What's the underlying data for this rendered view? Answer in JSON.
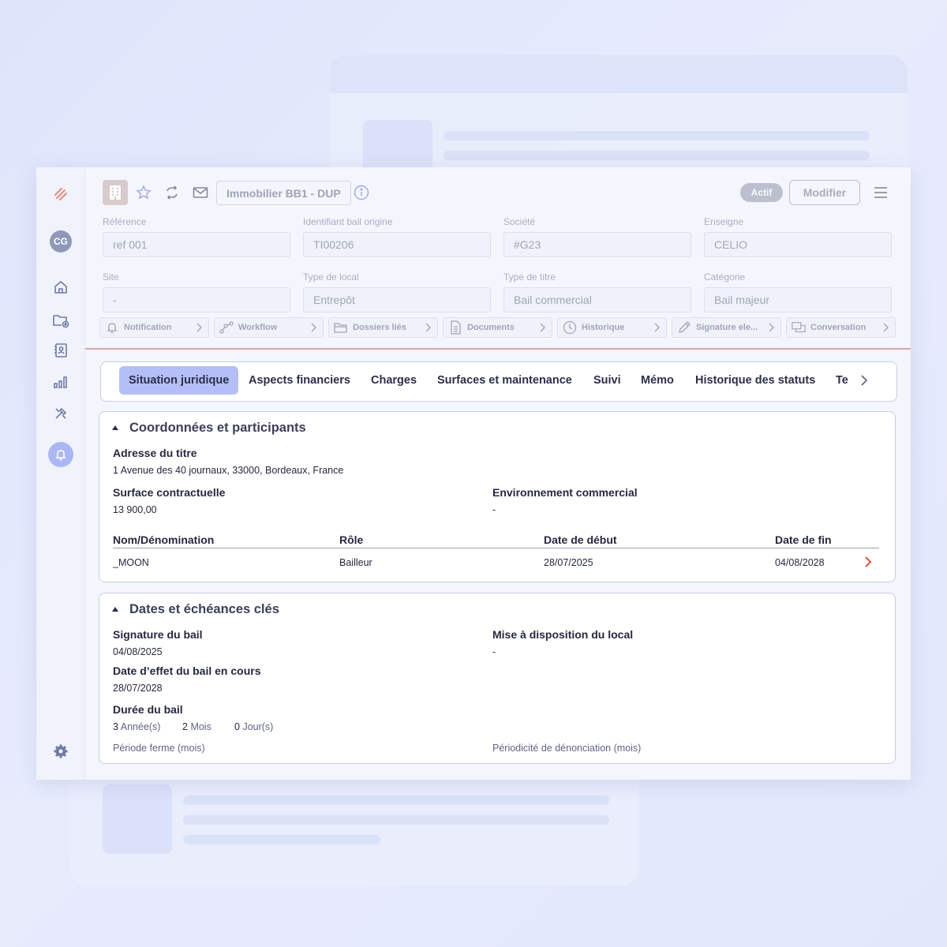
{
  "header": {
    "title": "Immobilier BB1 - DUP",
    "status": "Actif",
    "modify_label": "Modifier"
  },
  "sidebar": {
    "avatar_initials": "CG",
    "items": [
      "home-icon",
      "folder-add-icon",
      "contacts-icon",
      "chart-icon",
      "tools-icon",
      "bell-icon",
      "settings-icon"
    ]
  },
  "fields": [
    {
      "label": "Référence",
      "value": "ref 001"
    },
    {
      "label": "Identifiant bail origine",
      "value": "TI00206"
    },
    {
      "label": "Société",
      "value": "#G23"
    },
    {
      "label": "Enseigne",
      "value": "CELIO"
    },
    {
      "label": "Site",
      "value": "-"
    },
    {
      "label": "Type de local",
      "value": "Entrepôt"
    },
    {
      "label": "Type de titre",
      "value": "Bail commercial"
    },
    {
      "label": "Catégorie",
      "value": "Bail majeur"
    }
  ],
  "quick_links": [
    {
      "label": "Notification",
      "icon": "bell-icon"
    },
    {
      "label": "Workflow",
      "icon": "workflow-icon"
    },
    {
      "label": "Dossiers liés",
      "icon": "folder-icon"
    },
    {
      "label": "Documents",
      "icon": "document-icon"
    },
    {
      "label": "Historique",
      "icon": "clock-icon"
    },
    {
      "label": "Signature ele...",
      "icon": "pen-icon"
    },
    {
      "label": "Conversation",
      "icon": "chat-icon"
    }
  ],
  "tabs": [
    {
      "label": "Situation juridique",
      "active": true
    },
    {
      "label": "Aspects financiers"
    },
    {
      "label": "Charges"
    },
    {
      "label": "Surfaces et maintenance"
    },
    {
      "label": "Suivi"
    },
    {
      "label": "Mémo"
    },
    {
      "label": "Historique des statuts"
    },
    {
      "label": "Te"
    }
  ],
  "coords": {
    "title": "Coordonnées et participants",
    "address_label": "Adresse du titre",
    "address_value": "1 Avenue des 40 journaux, 33000, Bordeaux, France",
    "surface_label": "Surface contractuelle",
    "surface_value": "13 900,00",
    "env_label": "Environnement commercial",
    "env_value": "-",
    "table": {
      "headers": [
        "Nom/Dénomination",
        "Rôle",
        "Date de début",
        "Date de fin"
      ],
      "rows": [
        [
          "_MOON",
          "Bailleur",
          "28/07/2025",
          "04/08/2028"
        ]
      ]
    }
  },
  "dates": {
    "title": "Dates et échéances clés",
    "signature_label": "Signature du bail",
    "signature_value": "04/08/2025",
    "mise_label": "Mise à disposition du local",
    "mise_value": "-",
    "effet_label": "Date d’effet du bail en cours",
    "effet_value": "28/07/2028",
    "duree_label": "Durée du bail",
    "duree": [
      {
        "num": "3",
        "unit": "Année(s)"
      },
      {
        "num": "2",
        "unit": "Mois"
      },
      {
        "num": "0",
        "unit": "Jour(s)"
      }
    ],
    "periode_ferme": "Période ferme (mois)",
    "periodicite": "Périodicité de dénonciation (mois)"
  },
  "colors": {
    "accent": "#b4bff7",
    "chevron_accent": "#e0553a",
    "status_pill": "#8f94a8"
  }
}
